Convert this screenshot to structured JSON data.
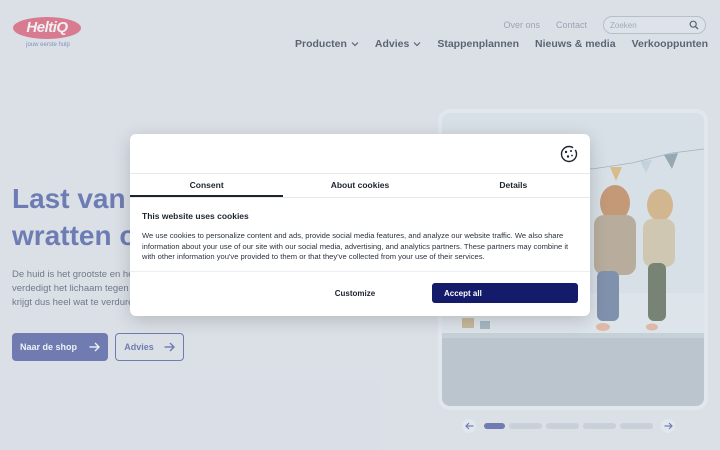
{
  "logo": {
    "name": "HeltiQ",
    "tagline": "jouw eerste hulp",
    "color": "#e0607a"
  },
  "header": {
    "links": [
      "Over ons",
      "Contact"
    ],
    "search_placeholder": "Zoeken",
    "nav": {
      "producten": "Producten",
      "advies": "Advies",
      "stappenplannen": "Stappenplannen",
      "nieuws": "Nieuws & media",
      "verkooppunten": "Verkooppunten"
    }
  },
  "hero": {
    "title_line1": "Last van",
    "title_line2": "wratten o",
    "body_line1": "De huid is het grootste en he",
    "body_line2": "verdedigt het lichaam tegen i",
    "body_line3": "krijgt dus heel wat te verdure",
    "shop_button": "Naar de shop",
    "advies_button": "Advies"
  },
  "carousel": {
    "slides": 5,
    "active": 1
  },
  "cookie_dialog": {
    "tabs": [
      "Consent",
      "About cookies",
      "Details"
    ],
    "active_tab": "Consent",
    "heading": "This website uses cookies",
    "text": "We use cookies to personalize content and ads, provide social media features, and analyze our website traffic. We also share information about your use of our site with our social media, advertising, and analytics partners. These partners may combine it with other information you've provided to them or that they've collected from your use of their services.",
    "customize_label": "Customize",
    "accept_label": "Accept all",
    "accept_color": "#141b6a"
  },
  "colors": {
    "brand_blue": "#5663a6",
    "title_blue": "#5264a8"
  }
}
